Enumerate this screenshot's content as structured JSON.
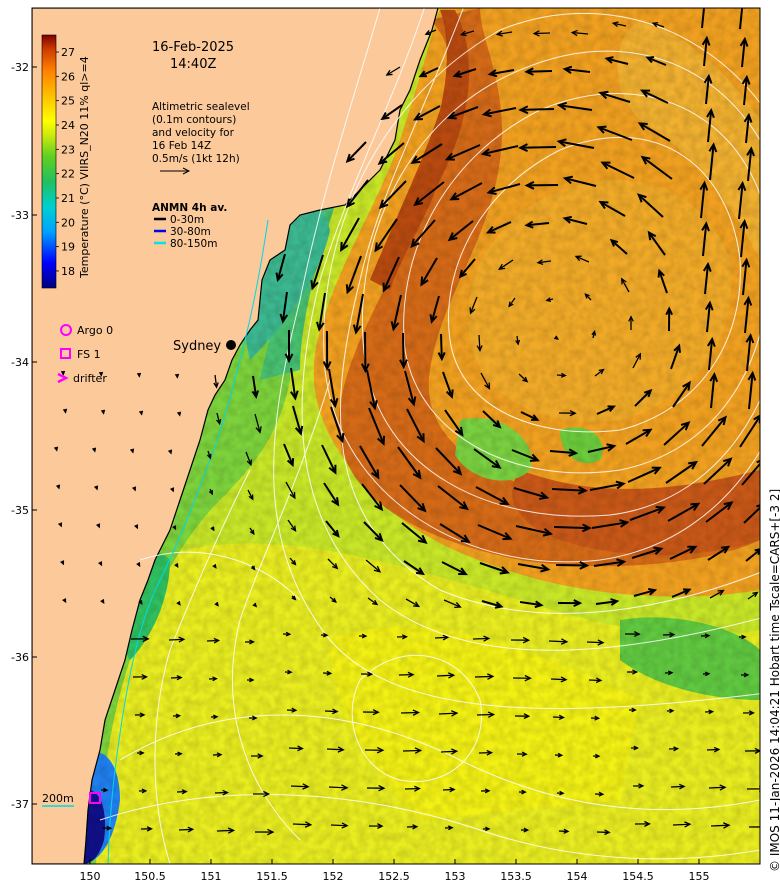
{
  "date": "16-Feb-2025",
  "time": "14:40Z",
  "legend_notes": [
    "Altimetric sealevel",
    "(0.1m contours)",
    "and velocity for",
    "16 Feb 14Z",
    "0.5m/s (1kt 12h)"
  ],
  "anmn": {
    "title": "ANMN 4h av.",
    "items": [
      {
        "label": "0-30m",
        "color": "#000000"
      },
      {
        "label": "30-80m",
        "color": "#0000ff"
      },
      {
        "label": "80-150m",
        "color": "#00e5e5"
      }
    ]
  },
  "markers": [
    {
      "label": "Argo 0",
      "shape": "circle-icon",
      "color": "#ff00ff"
    },
    {
      "label": "FS 1",
      "shape": "square-icon",
      "color": "#ff00ff"
    },
    {
      "label": "drifter",
      "shape": "chevron-icon",
      "color": "#ff00ff"
    }
  ],
  "city": "Sydney",
  "depth_label": "200m",
  "colorbar": {
    "title": "Temperature (°C) VIIRS_N20 11% ql>=4",
    "ticks": [
      "27",
      "26",
      "25",
      "24",
      "23",
      "22",
      "21",
      "20",
      "19",
      "18"
    ],
    "min": 17.3,
    "max": 27.7
  },
  "lon_ticks": [
    "150",
    "150.5",
    "151",
    "151.5",
    "152",
    "152.5",
    "153",
    "153.5",
    "154",
    "154.5",
    "155"
  ],
  "lat_ticks": [
    "-32",
    "-33",
    "-34",
    "-35",
    "-36",
    "-37"
  ],
  "credit": "© IMOS 11-Jan-2026 14:04:21 Hobart time Tscale=CARS+[-3 2]",
  "colors": {
    "land": "#fbc99a",
    "coast": "#000000",
    "contour": "#ffffff",
    "warm_core": "#e0781c",
    "inshore": "#3cc88c"
  }
}
